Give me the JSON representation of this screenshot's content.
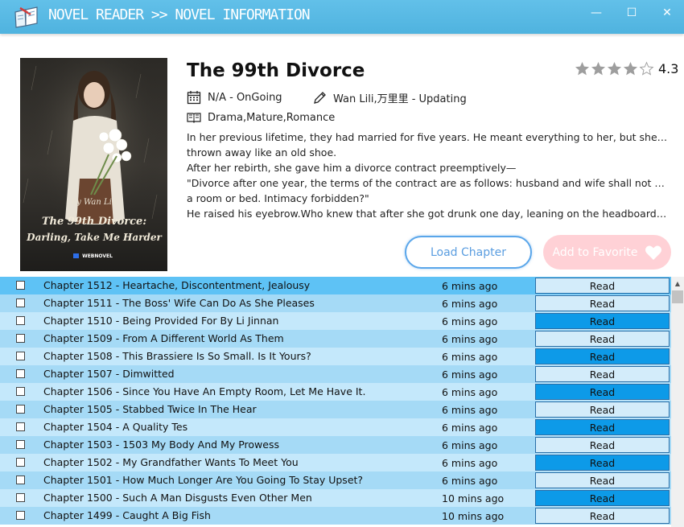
{
  "window": {
    "title": "NOVEL READER >> NOVEL INFORMATION",
    "minimize": "—",
    "maximize": "☐",
    "close": "✕"
  },
  "novel": {
    "title": "The 99th Divorce",
    "rating": 4.3,
    "rating_text": "4.3",
    "status": "N/A - OnGoing",
    "author": "Wan Lili,万里里 - Updating",
    "genres": "Drama,Mature,Romance",
    "description": [
      "In her previous lifetime, they had married for five years. He meant everything to her, but she was",
      "thrown away like an old shoe.",
      "After her rebirth, she gave him a divorce contract preemptively—",
      "\"Divorce after one year, the terms of the contract are as follows: husband and wife shall not share",
      "a room or bed. Intimacy forbidden?\"",
      "He raised his eyebrow.Who knew that after she got drunk one day, leaning on the headboard, h..."
    ],
    "cover": {
      "author_line": "by Wan Lili",
      "title_line1": "The 99th Divorce:",
      "title_line2": "Darling, Take Me Harder",
      "publisher": "WEBNOVEL"
    }
  },
  "buttons": {
    "load_chapter": "Load Chapter",
    "add_favorite": "Add to Favorite"
  },
  "chapters": [
    {
      "title": "Chapter 1512 - Heartache, Discontentment, Jealousy",
      "time": "6 mins ago",
      "action": "Read"
    },
    {
      "title": "Chapter 1511 - The Boss' Wife Can Do As She Pleases",
      "time": "6 mins ago",
      "action": "Read"
    },
    {
      "title": "Chapter 1510 - Being Provided For By Li Jinnan",
      "time": "6 mins ago",
      "action": "Read"
    },
    {
      "title": "Chapter 1509 - From A Different World As Them",
      "time": "6 mins ago",
      "action": "Read"
    },
    {
      "title": "Chapter 1508 - This Brassiere Is So Small. Is It Yours?",
      "time": "6 mins ago",
      "action": "Read"
    },
    {
      "title": "Chapter 1507 - Dimwitted",
      "time": "6 mins ago",
      "action": "Read"
    },
    {
      "title": "Chapter 1506 - Since You Have An Empty Room, Let Me Have It.",
      "time": "6 mins ago",
      "action": "Read"
    },
    {
      "title": "Chapter 1505 - Stabbed Twice In The Hear",
      "time": "6 mins ago",
      "action": "Read"
    },
    {
      "title": "Chapter 1504 - A Quality Tes",
      "time": "6 mins ago",
      "action": "Read"
    },
    {
      "title": "Chapter 1503 - 1503 My Body And My Prowess",
      "time": "6 mins ago",
      "action": "Read"
    },
    {
      "title": "Chapter 1502 - My Grandfather Wants To Meet You",
      "time": "6 mins ago",
      "action": "Read"
    },
    {
      "title": "Chapter 1501 - How Much Longer Are You Going To Stay Upset?",
      "time": "6 mins ago",
      "action": "Read"
    },
    {
      "title": "Chapter 1500 - Such A Man Disgusts Even Other Men",
      "time": "10 mins ago",
      "action": "Read"
    },
    {
      "title": "Chapter 1499 - Caught A Big Fish",
      "time": "10 mins ago",
      "action": "Read"
    }
  ],
  "colors": {
    "titlebar": "#55b7e2",
    "row_selected": "#5ec2f5",
    "row_even": "#c4e8fb",
    "row_odd": "#a5daf6",
    "read_button_light": "#d3ecfa",
    "read_button_dark": "#0d9ae8",
    "load_border": "#5aa6ea",
    "favorite_bg": "#ffd1d6"
  },
  "icons": {
    "app": "book-icon",
    "status": "calendar-icon",
    "author": "pencil-icon",
    "genres": "book-open-icon",
    "favorite": "heart-icon"
  }
}
